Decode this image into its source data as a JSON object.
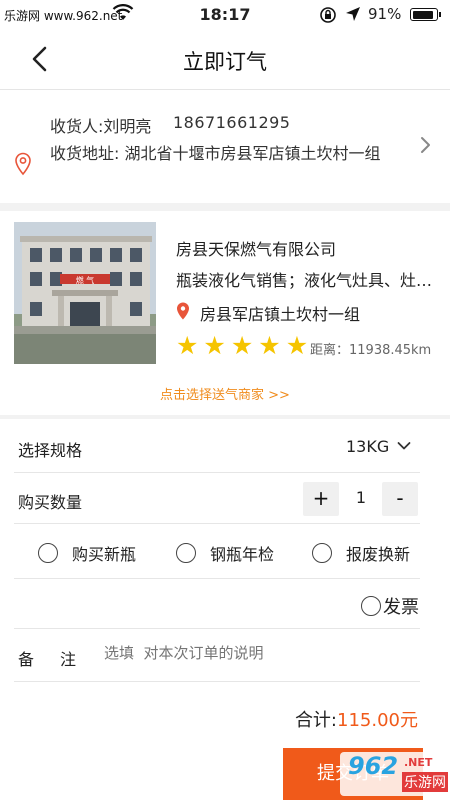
{
  "status_bar": {
    "carrier": "乐游网 www.962.net",
    "time": "18:17",
    "battery_pct": "91%",
    "battery_level": 0.91
  },
  "nav": {
    "title": "立即订气",
    "back_icon": "chevron-left-icon"
  },
  "address": {
    "recipient": "收货人:刘明亮",
    "phone": "18671661295",
    "address": "收货地址:  湖北省十堰市房县军店镇土坎村一组"
  },
  "merchant": {
    "name": "房县天保燃气有限公司",
    "description": "瓶装液化气销售；液化气灶具、灶具配件销售",
    "location": "房县军店镇土坎村一组",
    "rating": 5,
    "rating_max": 5,
    "distance": "距离：11938.45km",
    "choose_link": "点击选择送气商家  >>",
    "sign_text": "燃 气"
  },
  "spec": {
    "label": "选择规格",
    "value": "13KG"
  },
  "quantity": {
    "label": "购买数量",
    "plus": "+",
    "value": "1",
    "minus": "-"
  },
  "options": [
    {
      "label": "购买新瓶"
    },
    {
      "label": "钢瓶年检"
    },
    {
      "label": "报废换新"
    }
  ],
  "invoice": {
    "label": "发票"
  },
  "remark": {
    "label": "备注",
    "placeholder": "选填  对本次订单的说明"
  },
  "total": {
    "label": "合计:",
    "amount": "115.00元"
  },
  "submit": {
    "label": "提交订单"
  },
  "watermark": {
    "number": "962",
    "net": ".NET",
    "site": "乐游网"
  },
  "colors": {
    "accent": "#f05a1a",
    "link": "#f08c1d",
    "star": "#f5c400",
    "pin": "#e8553a"
  }
}
